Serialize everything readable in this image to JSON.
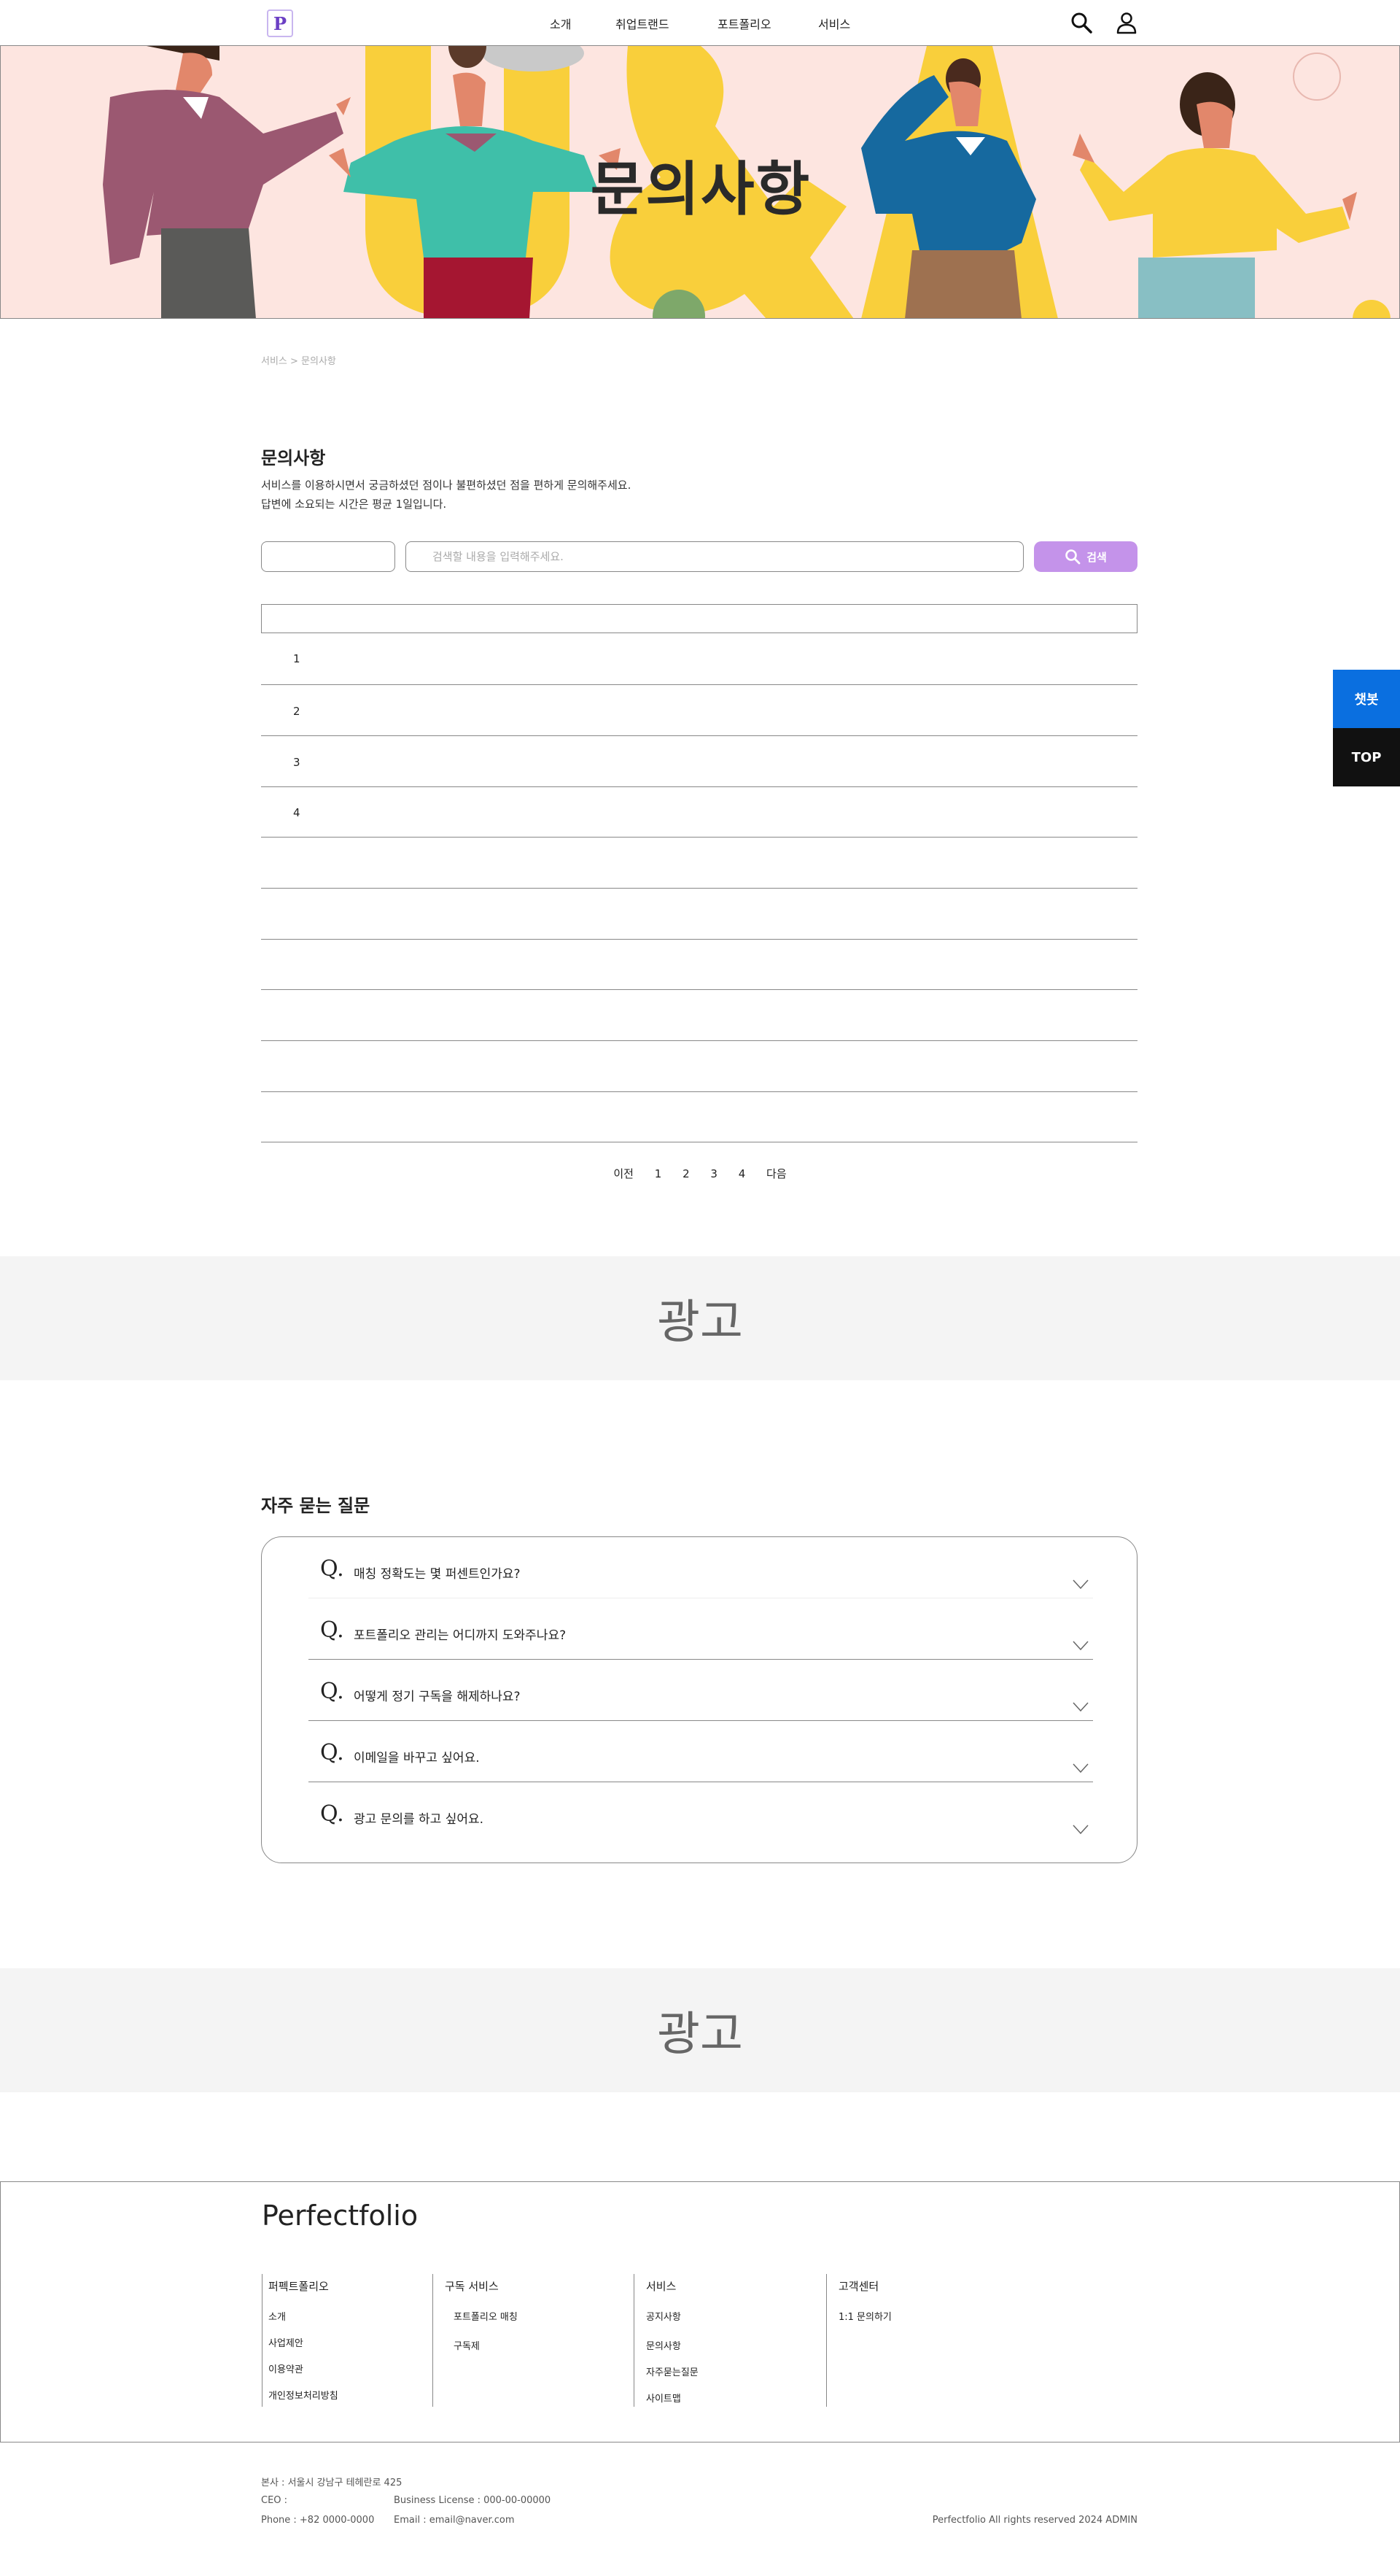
{
  "header": {
    "logo_letter": "P",
    "nav": [
      "소개",
      "취업트랜드",
      "포트폴리오",
      "서비스"
    ],
    "icons": [
      "search-icon",
      "user-icon"
    ]
  },
  "hero": {
    "title": "문의사항",
    "bg_color": "#fde5e0"
  },
  "breadcrumb": "서비스 > 문의사항",
  "intro": {
    "title": "문의사항",
    "desc_line1": "서비스를 이용하시면서 궁금하셨던 점이나 불편하셨던 점을 편하게 문의해주세요.",
    "desc_line2": "답변에 소요되는 시간은 평균 1일입니다."
  },
  "search": {
    "select_value": "",
    "placeholder": "검색할 내용을 입력해주세요.",
    "button_label": "검색",
    "button_color": "#c493ea"
  },
  "table": {
    "header": "",
    "rows": [
      "1",
      "2",
      "3",
      "4",
      "",
      "",
      "",
      "",
      "",
      ""
    ]
  },
  "pagination": {
    "prev": "이전",
    "pages": [
      "1",
      "2",
      "3",
      "4"
    ],
    "next": "다음"
  },
  "ads": [
    "광고",
    "광고"
  ],
  "faq": {
    "title": "자주 묻는 질문",
    "q_mark": "Q.",
    "items": [
      "매칭 정확도는 몇 퍼센트인가요?",
      "포트폴리오 관리는 어디까지 도와주나요?",
      "어떻게 정기 구독을 해제하나요?",
      "이메일을 바꾸고 싶어요.",
      "광고 문의를 하고 싶어요."
    ]
  },
  "floating": {
    "chatbot": "챗봇",
    "chatbot_color": "#0a6fe0",
    "top": "TOP",
    "top_color": "#111111"
  },
  "footer": {
    "brand": "Perfectfolio",
    "columns": [
      {
        "title": "퍼펙트폴리오",
        "links": [
          "소개",
          "사업제안",
          "이용약관",
          "개인정보처리방침"
        ]
      },
      {
        "title": "구독 서비스",
        "links": [
          "포트폴리오 매칭",
          "구독제"
        ]
      },
      {
        "title": "서비스",
        "links": [
          "공지사항",
          "문의사항",
          "자주묻는질문",
          "사이트맵"
        ]
      },
      {
        "title": "고객센터",
        "links": [
          "1:1 문의하기"
        ]
      }
    ],
    "address": "본사 : 서울시 강남구 테헤란로 425",
    "ceo": "CEO :",
    "license": "Business License : 000-00-00000",
    "phone": "Phone : +82 0000-0000",
    "email": "Email : email@naver.com",
    "copyright": "Perfectfolio All rights reserved 2024 ADMIN"
  }
}
